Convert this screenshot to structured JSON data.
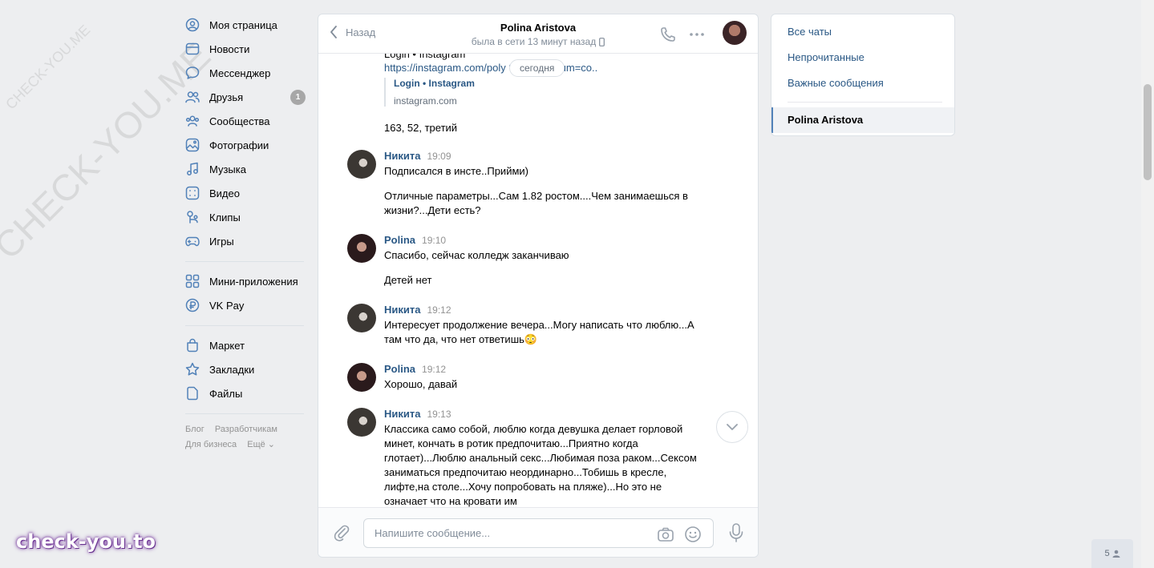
{
  "nav": {
    "items": [
      {
        "label": "Моя страница",
        "icon": "user-circle-icon"
      },
      {
        "label": "Новости",
        "icon": "news-icon"
      },
      {
        "label": "Мессенджер",
        "icon": "chat-bubble-icon"
      },
      {
        "label": "Друзья",
        "icon": "friends-icon",
        "badge": "1"
      },
      {
        "label": "Сообщества",
        "icon": "groups-icon"
      },
      {
        "label": "Фотографии",
        "icon": "photo-icon"
      },
      {
        "label": "Музыка",
        "icon": "music-note-icon"
      },
      {
        "label": "Видео",
        "icon": "video-icon"
      },
      {
        "label": "Клипы",
        "icon": "clips-icon"
      },
      {
        "label": "Игры",
        "icon": "gamepad-icon"
      }
    ],
    "items2": [
      {
        "label": "Мини-приложения",
        "icon": "apps-grid-icon"
      },
      {
        "label": "VK Pay",
        "icon": "ruble-icon"
      }
    ],
    "items3": [
      {
        "label": "Маркет",
        "icon": "shopping-bag-icon"
      },
      {
        "label": "Закладки",
        "icon": "star-icon"
      },
      {
        "label": "Файлы",
        "icon": "file-icon"
      }
    ],
    "footer": [
      "Блог",
      "Разработчикам",
      "Для бизнеса",
      "Ещё ⌄"
    ]
  },
  "chat": {
    "back_label": "Назад",
    "peer_name": "Polina Aristova",
    "peer_status": "была в сети 13 минут назад",
    "date_pill": "сегодня",
    "cut_top_text": "Login • Instagram",
    "link_text": "https://instagram.com/poly                              ?utm_medium=co..",
    "snippet_title": "Login • Instagram",
    "snippet_domain": "instagram.com",
    "plain_text": "163, 52, третий",
    "messages": [
      {
        "author": "Никита",
        "time": "19:09",
        "paragraphs": [
          "Подписался в инсте..Прийми)",
          "Отличные параметры...Сам 1.82 ростом....Чем занимаешься в жизни?...Дети есть?"
        ]
      },
      {
        "author": "Polina",
        "time": "19:10",
        "paragraphs": [
          "Спасибо, сейчас колледж заканчиваю",
          "Детей нет"
        ]
      },
      {
        "author": "Никита",
        "time": "19:12",
        "paragraphs": [
          "Интересует продолжение вечера...Могу написать что люблю...А там что да, что нет ответишь😳"
        ]
      },
      {
        "author": "Polina",
        "time": "19:12",
        "paragraphs": [
          "Хорошо, давай"
        ]
      },
      {
        "author": "Никита",
        "time": "19:13",
        "paragraphs": [
          "Классика само собой, люблю когда девушка делает горловой минет, кончать в ротик предпочитаю...Приятно когда глотает)...Люблю анальный секс...Любимая поза раком...Сексом заниматься предпочитаю неординарно...Тобишь в кресле, лифте,на столе...Хочу попробовать на пляже)...Но это не означает что на кровати им"
        ]
      }
    ],
    "composer_placeholder": "Напишите сообщение..."
  },
  "right_panel": {
    "items": [
      "Все чаты",
      "Непрочитанные",
      "Важные сообщения"
    ],
    "active": "Polina Aristova"
  },
  "watermarks": {
    "small": "CHECK-YOU.ME",
    "big": "CHECK-YOU.ME",
    "brand": "check-you.to"
  },
  "online_count": "5"
}
